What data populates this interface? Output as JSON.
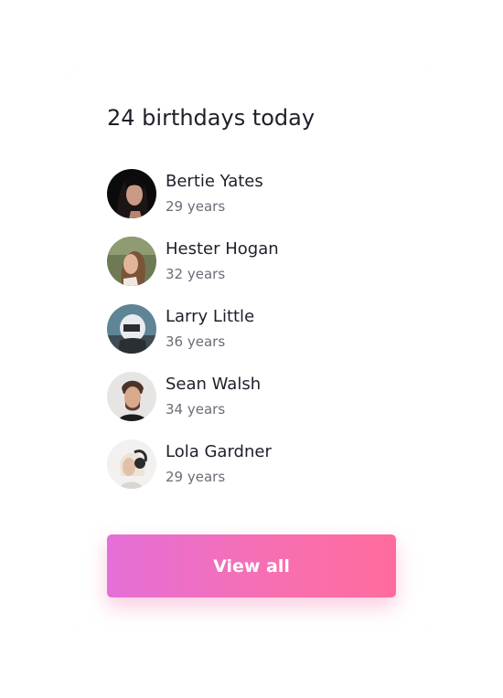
{
  "header": {
    "title": "24 birthdays today"
  },
  "people": [
    {
      "name": "Bertie Yates",
      "age": "29 years",
      "avatar_icon": "person-avatar-dark-hair"
    },
    {
      "name": "Hester Hogan",
      "age": "32 years",
      "avatar_icon": "person-avatar-outdoor"
    },
    {
      "name": "Larry Little",
      "age": "36 years",
      "avatar_icon": "person-avatar-helmet"
    },
    {
      "name": "Sean Walsh",
      "age": "34 years",
      "avatar_icon": "person-avatar-beard"
    },
    {
      "name": "Lola Gardner",
      "age": "29 years",
      "avatar_icon": "person-avatar-headphones"
    }
  ],
  "actions": {
    "view_all_label": "View all"
  },
  "colors": {
    "button_gradient_start": "#e46fd7",
    "button_gradient_end": "#ff6b9d",
    "text_primary": "#1f1f2b",
    "text_secondary": "#6c6c78"
  }
}
